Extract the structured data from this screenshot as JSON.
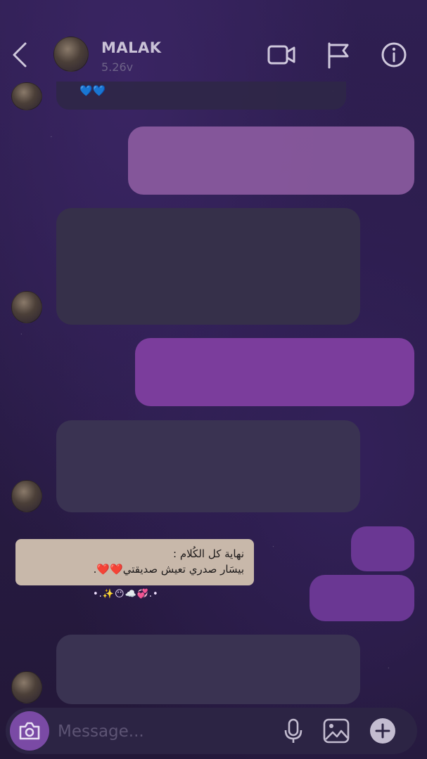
{
  "header": {
    "name": "MALAK",
    "status": "5.26v"
  },
  "messages": {
    "top_emoji": "💙💙",
    "caption_line1": "نهاية كل الكُلام :",
    "caption_line2": "بيسَار صدري تعيش صديقتي❤️❤️.",
    "sparkles": "•.✨😶☁️💞.•"
  },
  "composer": {
    "placeholder": "Message..."
  },
  "colors": {
    "background": "#2a1d48",
    "outgoing_bubble": "#7b3d9c",
    "incoming_bubble": "#3a3352",
    "caption_bg": "#c8b8aa"
  },
  "icons": [
    "back-icon",
    "video-call-icon",
    "flag-icon",
    "info-icon",
    "camera-icon",
    "microphone-icon",
    "gallery-icon",
    "plus-icon"
  ]
}
